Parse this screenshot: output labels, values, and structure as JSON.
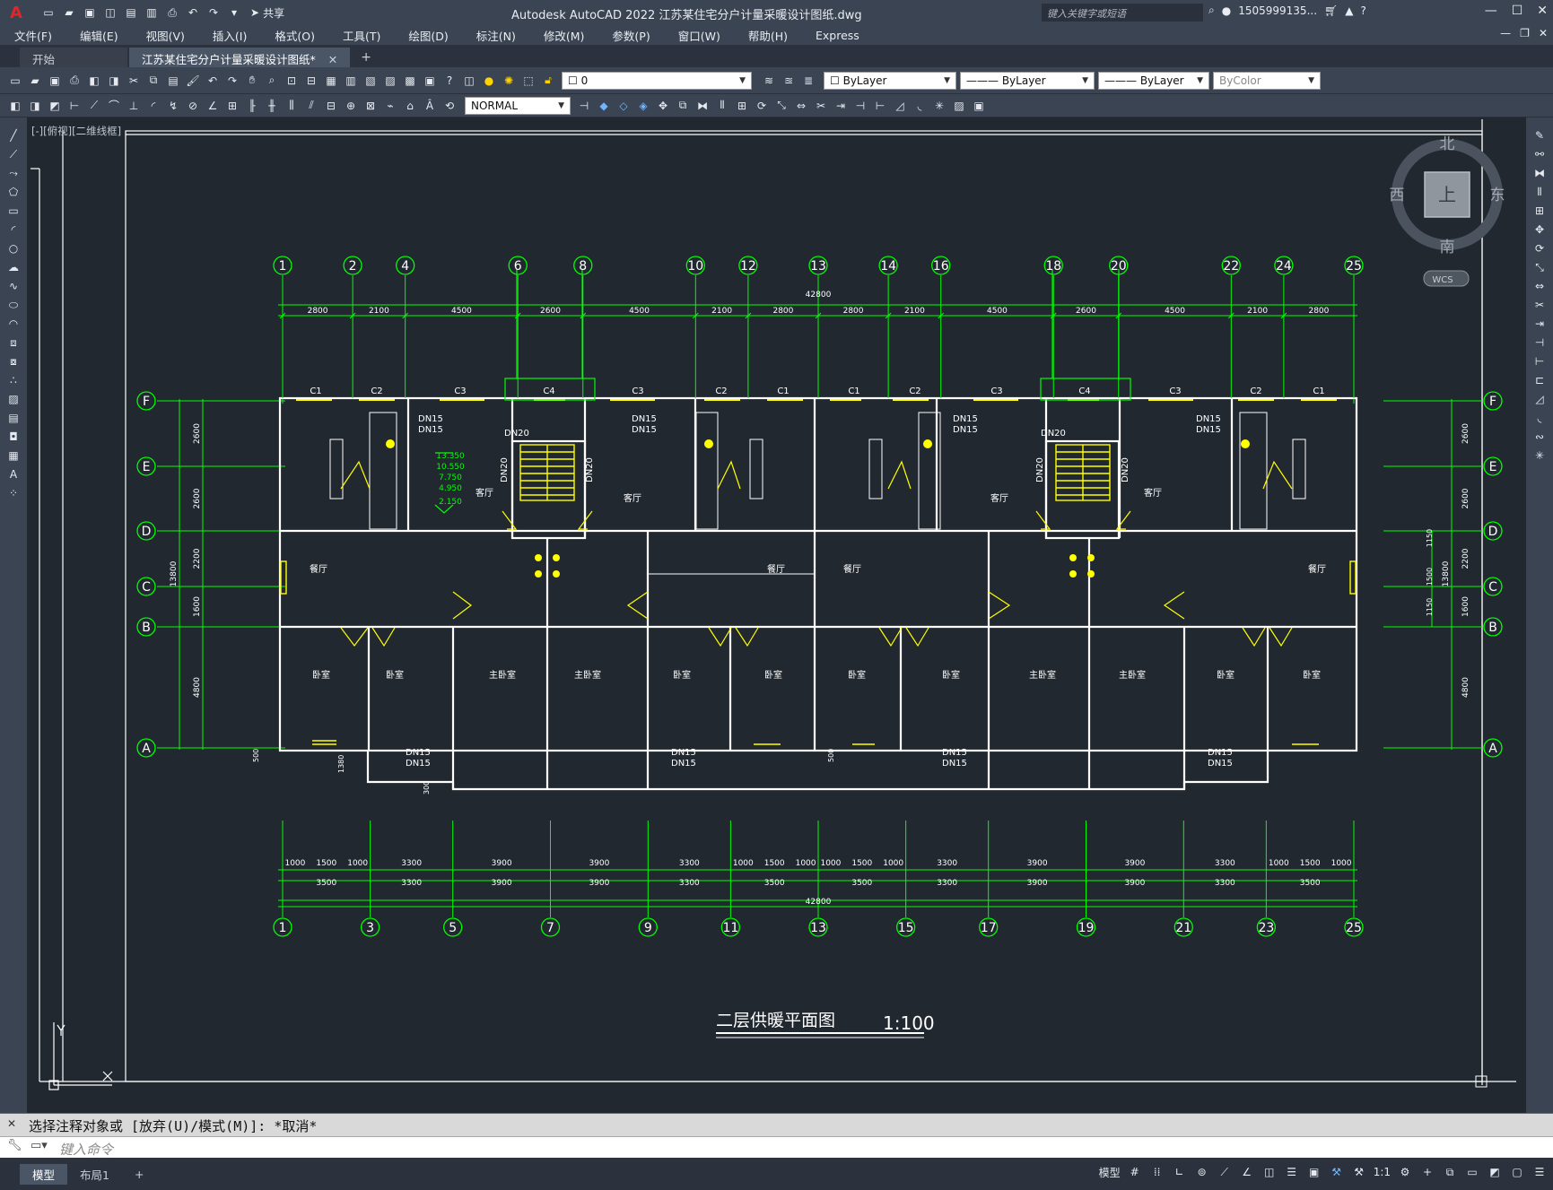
{
  "app": {
    "window_title": "Autodesk AutoCAD 2022    江苏某住宅分户计量采暖设计图纸.dwg",
    "share_label": "共享",
    "search_placeholder": "键入关键字或短语",
    "user_label": "1505999135...",
    "colors": {
      "chrome": "#3b4453",
      "canvas": "#212830",
      "draw_green": "#00ff00",
      "draw_white": "#ffffff",
      "draw_yellow": "#ffff00"
    }
  },
  "menubar": {
    "items": [
      "文件(F)",
      "编辑(E)",
      "视图(V)",
      "插入(I)",
      "格式(O)",
      "工具(T)",
      "绘图(D)",
      "标注(N)",
      "修改(M)",
      "参数(P)",
      "窗口(W)",
      "帮助(H)",
      "Express"
    ]
  },
  "tabs": {
    "start": "开始",
    "active_doc": "江苏某住宅分户计量采暖设计图纸*"
  },
  "properties": {
    "layer_value": "0",
    "text_style": "NORMAL",
    "color": "ByLayer",
    "linetype": "ByLayer",
    "lineweight": "ByLayer",
    "plotstyle": "ByColor"
  },
  "viewport": {
    "label": "[-][俯视][二维线框]",
    "viewcube": {
      "north": "北",
      "south": "南",
      "east": "东",
      "west": "西",
      "top": "上",
      "wcs": "WCS"
    }
  },
  "drawing": {
    "title": "二层供暖平面图",
    "scale": "1:100",
    "total_dim": "42800",
    "top_axes": [
      "1",
      "2",
      "4",
      "6",
      "8",
      "10",
      "12",
      "13",
      "14",
      "16",
      "18",
      "20",
      "22",
      "24",
      "25"
    ],
    "top_dims": [
      "2800",
      "2100",
      "4500",
      "2600",
      "4500",
      "2100",
      "2800",
      "2800",
      "2100",
      "4500",
      "2600",
      "4500",
      "2100",
      "2800"
    ],
    "bottom_axes": [
      "1",
      "3",
      "5",
      "7",
      "9",
      "11",
      "13",
      "15",
      "17",
      "19",
      "21",
      "23",
      "25"
    ],
    "bottom_dims_row1": [
      "1000",
      "1500",
      "1000",
      "3300",
      "3900",
      "3900",
      "3300",
      "1000",
      "1500",
      "1000",
      "1000",
      "1500",
      "1000",
      "3300",
      "3900",
      "3900",
      "3300",
      "1000",
      "1500",
      "1000"
    ],
    "bottom_dims_row2": [
      "3500",
      "3300",
      "3900",
      "3900",
      "3300",
      "3500",
      "3500",
      "3300",
      "3900",
      "3900",
      "3300",
      "3500"
    ],
    "row_axes": [
      "F",
      "E",
      "D",
      "C",
      "B",
      "A"
    ],
    "left_dims": [
      "2600",
      "2600",
      "2200",
      "1600",
      "4800"
    ],
    "left_total": "13800",
    "right_dims_inner": [
      "1150",
      "1500",
      "1150"
    ],
    "elevations": [
      "13.350",
      "10.550",
      "7.750",
      "4.950",
      "2.150"
    ],
    "windows_top": [
      "C1",
      "C2",
      "C3",
      "C4",
      "C3",
      "C2",
      "C1",
      "C1",
      "C2",
      "C3",
      "C4",
      "C3",
      "C2",
      "C1"
    ],
    "rooms": {
      "living": "客厅",
      "dining": "餐厅",
      "bedroom": "卧室",
      "master": "主卧室"
    },
    "pipe_label": "DN15",
    "riser_label": "DN20",
    "misc_dims": [
      "500",
      "1380",
      "300"
    ]
  },
  "command": {
    "history": "选择注释对象或 [放弃(U)/模式(M)]: *取消*",
    "placeholder": "键入命令"
  },
  "status": {
    "model_tab": "模型",
    "layout_tab": "布局1",
    "model_label": "模型",
    "scale": "1:1"
  }
}
